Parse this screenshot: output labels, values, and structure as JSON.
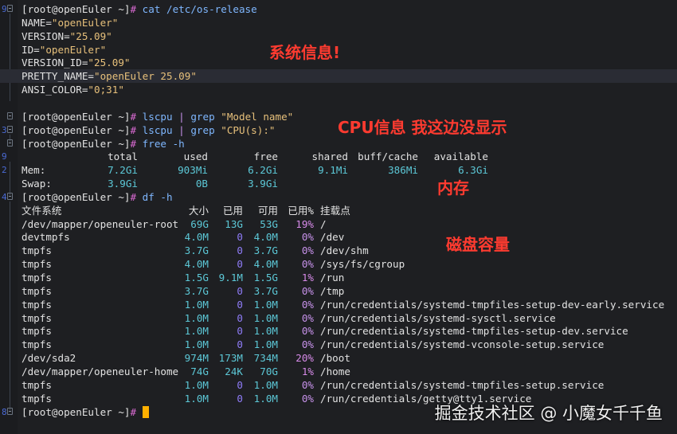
{
  "terminal": {
    "prompt": "[root@openEuler ~]",
    "hash": "#",
    "commands": {
      "cat": "cat",
      "cat_arg": "/etc/os-release",
      "lscpu": "lscpu",
      "pipe": "|",
      "grep": "grep",
      "grep_model": "\"Model name\"",
      "grep_cpu": "\"CPU(s):\"",
      "free": "free",
      "free_arg": "-h",
      "df": "df",
      "df_arg": "-h"
    },
    "os_release": [
      {
        "key": "NAME=",
        "value": "\"openEuler\""
      },
      {
        "key": "VERSION=",
        "value": "\"25.09\""
      },
      {
        "key": "ID=",
        "value": "\"openEuler\""
      },
      {
        "key": "VERSION_ID=",
        "value": "\"25.09\""
      },
      {
        "key": "PRETTY_NAME=",
        "value": "\"openEuler 25.09\""
      },
      {
        "key": "ANSI_COLOR=",
        "value": "\"0;31\""
      }
    ],
    "free": {
      "headers": [
        "total",
        "used",
        "free",
        "shared",
        "buff/cache",
        "available"
      ],
      "rows": [
        {
          "label": "Mem:",
          "values": [
            "7.2Gi",
            "903Mi",
            "6.2Gi",
            "9.1Mi",
            "386Mi",
            "6.3Gi"
          ]
        },
        {
          "label": "Swap:",
          "values": [
            "3.9Gi",
            "0B",
            "3.9Gi",
            "",
            "",
            ""
          ]
        }
      ]
    },
    "df": {
      "headers": [
        "文件系统",
        "大小",
        "已用",
        "可用",
        "已用%",
        "挂载点"
      ],
      "rows": [
        [
          "/dev/mapper/openeuler-root",
          "69G",
          "13G",
          "53G",
          "19%",
          "/"
        ],
        [
          "devtmpfs",
          "4.0M",
          "0",
          "4.0M",
          "0%",
          "/dev"
        ],
        [
          "tmpfs",
          "3.7G",
          "0",
          "3.7G",
          "0%",
          "/dev/shm"
        ],
        [
          "tmpfs",
          "4.0M",
          "0",
          "4.0M",
          "0%",
          "/sys/fs/cgroup"
        ],
        [
          "tmpfs",
          "1.5G",
          "9.1M",
          "1.5G",
          "1%",
          "/run"
        ],
        [
          "tmpfs",
          "3.7G",
          "0",
          "3.7G",
          "0%",
          "/tmp"
        ],
        [
          "tmpfs",
          "1.0M",
          "0",
          "1.0M",
          "0%",
          "/run/credentials/systemd-tmpfiles-setup-dev-early.service"
        ],
        [
          "tmpfs",
          "1.0M",
          "0",
          "1.0M",
          "0%",
          "/run/credentials/systemd-sysctl.service"
        ],
        [
          "tmpfs",
          "1.0M",
          "0",
          "1.0M",
          "0%",
          "/run/credentials/systemd-tmpfiles-setup-dev.service"
        ],
        [
          "tmpfs",
          "1.0M",
          "0",
          "1.0M",
          "0%",
          "/run/credentials/systemd-vconsole-setup.service"
        ],
        [
          "/dev/sda2",
          "974M",
          "173M",
          "734M",
          "20%",
          "/boot"
        ],
        [
          "/dev/mapper/openeuler-home",
          "74G",
          "24K",
          "70G",
          "1%",
          "/home"
        ],
        [
          "tmpfs",
          "1.0M",
          "0",
          "1.0M",
          "0%",
          "/run/credentials/systemd-tmpfiles-setup.service"
        ],
        [
          "tmpfs",
          "1.0M",
          "0",
          "1.0M",
          "0%",
          "/run/credentials/getty@tty1.service"
        ]
      ]
    },
    "line_numbers": [
      "9",
      "",
      "",
      "",
      "",
      "",
      "",
      "",
      "",
      "3",
      "",
      "9",
      "2",
      "",
      "4",
      "",
      "",
      "",
      "",
      "",
      "",
      "",
      "",
      "",
      "",
      "",
      "",
      "",
      "",
      "",
      "8"
    ]
  },
  "annotations": {
    "system_info": "系统信息!",
    "cpu_info": "CPU信息 我这边没显示",
    "memory": "内存",
    "disk": "磁盘容量"
  },
  "watermark": "掘金技术社区 @ 小魔女千千鱼",
  "colors": {
    "background": "#1e1f22",
    "annotation": "#ff3b30",
    "cursor": "#ffb000",
    "command": "#7fb7ff",
    "string": "#e7c07b",
    "prompt_hash": "#d96ad2"
  }
}
